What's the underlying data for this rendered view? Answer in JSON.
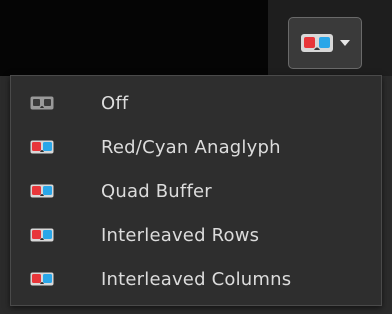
{
  "toolbar": {
    "stereo_button": {
      "icon": "anaglyph-glasses-icon",
      "caret_icon": "chevron-down-icon"
    }
  },
  "stereo_menu": {
    "items": [
      {
        "label": "Off",
        "icon": "glasses-off-icon"
      },
      {
        "label": "Red/Cyan Anaglyph",
        "icon": "anaglyph-glasses-icon"
      },
      {
        "label": "Quad Buffer",
        "icon": "anaglyph-glasses-icon"
      },
      {
        "label": "Interleaved Rows",
        "icon": "anaglyph-glasses-icon"
      },
      {
        "label": "Interleaved Columns",
        "icon": "anaglyph-glasses-icon"
      }
    ]
  },
  "colors": {
    "lens_red": "#e8363a",
    "lens_cyan": "#2aa6e8",
    "lens_off": "#9a9a9a",
    "frame": "#d8d8d8"
  }
}
